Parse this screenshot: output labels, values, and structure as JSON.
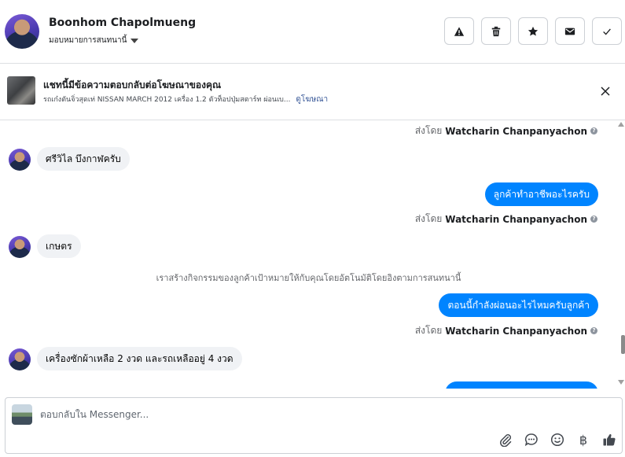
{
  "header": {
    "contact_name": "Boonhom Chapolmueng",
    "assign_label": "มอบหมายการสนทนานี้",
    "actions": [
      {
        "icon": "warning-icon"
      },
      {
        "icon": "trash-icon"
      },
      {
        "icon": "star-icon"
      },
      {
        "icon": "envelope-icon"
      },
      {
        "icon": "check-icon"
      }
    ]
  },
  "ad_banner": {
    "title": "แชทนี้มีข้อความตอบกลับต่อโฆษณาของคุณ",
    "description": "รถเก๋งตันจิ่วสุดเท่ NISSAN MARCH 2012 เครื่อง 1.2 ตัวท็อปปุ่มสตาร์ท ผ่อนเบ...",
    "link_label": "ดูโฆษณา"
  },
  "chat": {
    "sent_by_prefix": "ส่งโดย",
    "sent_by_name": "Watcharin Chanpanyachon",
    "help_glyph": "?",
    "messages": [
      {
        "from": "contact",
        "text": "ศรีวิไล บึงกาฬครับ"
      },
      {
        "from": "page",
        "text": "ลูกค้าทำอาชีพอะไรครับ"
      },
      {
        "from": "contact",
        "text": "เกษตร"
      },
      {
        "from": "system",
        "text": "เราสร้างกิจกรรมของลูกค้าเป้าหมายให้กับคุณโดยอัตโนมัติโดยอิงตามการสนทนานี้"
      },
      {
        "from": "page",
        "text": "ตอนนี้กำลังผ่อนอะไรไหมครับลูกค้า"
      },
      {
        "from": "contact",
        "text": "เครื่องซักผ้าเหลือ 2 งวด และรถเหลืออยู่ 4 งวด"
      }
    ]
  },
  "composer": {
    "placeholder": "ตอบกลับใน Messenger...",
    "tools": [
      "paperclip-icon",
      "chat-bubble-icon",
      "smiley-icon",
      "baht-icon",
      "thumbs-up-icon"
    ],
    "baht_glyph": "฿"
  },
  "colors": {
    "outgoing_bubble": "#0084ff",
    "incoming_bubble": "#f0f2f5",
    "link": "#385898"
  }
}
